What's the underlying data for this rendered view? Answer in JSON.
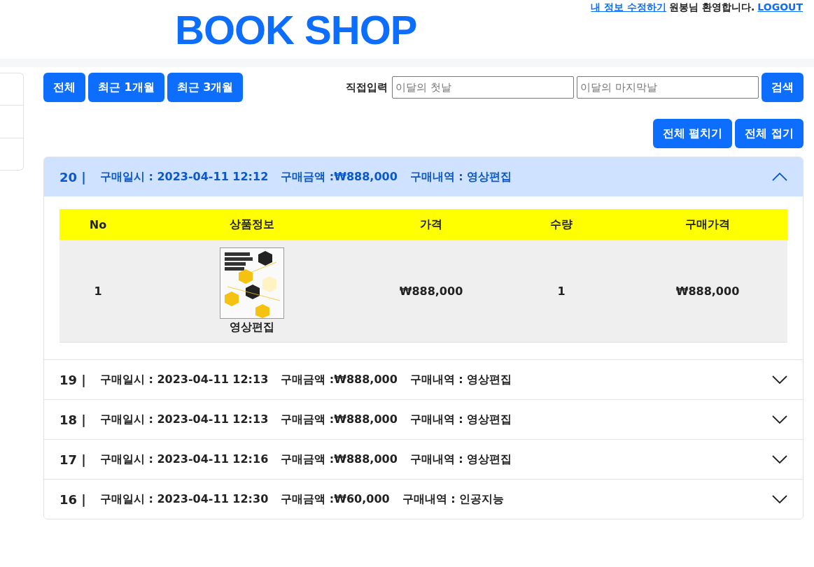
{
  "top_bar": {
    "profile_link": "내 정보 수정하기",
    "greeting": "원봉님 환영합니다.",
    "logout_link": "LOGOUT"
  },
  "title": "BOOK SHOP",
  "period_buttons": [
    {
      "label": "전체"
    },
    {
      "label": "최근 1개월"
    },
    {
      "label": "최근 3개월"
    }
  ],
  "direct_input": {
    "label": "직접입력",
    "start": {
      "placeholder": "이달의 첫날"
    },
    "end": {
      "placeholder": "이달의 마지막날"
    },
    "search_button": "검색"
  },
  "accordion_buttons": [
    "전체 펼치기",
    "전체 접기"
  ],
  "orders": [
    {
      "no": "20 |",
      "date": "구매일시 : 2023-04-11 12:12",
      "amount": "구매금액 :₩888,000",
      "items": "구매내역 : 영상편집",
      "expanded": true,
      "table": {
        "columns": [
          "No",
          "상품정보",
          "가격",
          "수량",
          "구매가격"
        ],
        "rows": [
          {
            "no": "1",
            "product": {
              "kind": "picture",
              "name": "영상편집"
            },
            "price": "₩888,000",
            "quantity": "1",
            "total": "₩888,000"
          }
        ]
      }
    },
    {
      "no": "19 |",
      "date": "구매일시 : 2023-04-11 12:13",
      "amount": "구매금액 :₩888,000",
      "items": "구매내역 : 영상편집",
      "expanded": false
    },
    {
      "no": "18 |",
      "date": "구매일시 : 2023-04-11 12:13",
      "amount": "구매금액 :₩888,000",
      "items": "구매내역 : 영상편집",
      "expanded": false
    },
    {
      "no": "17 |",
      "date": "구매일시 : 2023-04-11 12:16",
      "amount": "구매금액 :₩888,000",
      "items": "구매내역 : 영상편집",
      "expanded": false
    },
    {
      "no": "16 |",
      "date": "구매일시 : 2023-04-11 12:30",
      "amount": "구매금액 :₩60,000",
      "items": "구매내역 : 인공지능",
      "expanded": false
    }
  ]
}
